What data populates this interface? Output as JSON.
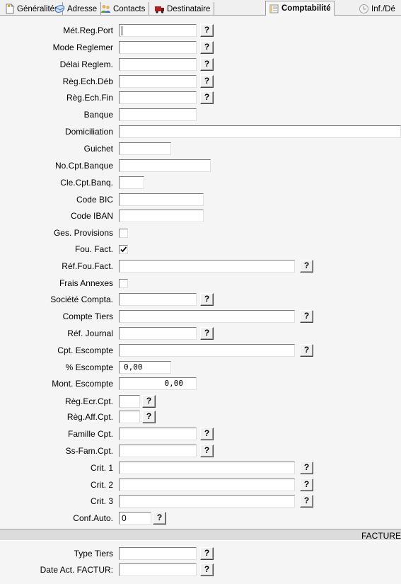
{
  "tabs": [
    {
      "label": "Généralités",
      "icon": "page-icon"
    },
    {
      "label": "Adresse",
      "icon": "envelope-icon"
    },
    {
      "label": "Contacts",
      "icon": "people-icon"
    },
    {
      "label": "Destinataire",
      "icon": "truck-icon"
    },
    {
      "label": "Comptabilité",
      "icon": "ledger-icon",
      "active": true
    },
    {
      "label": "Inf./Dé",
      "icon": "clock-icon"
    }
  ],
  "fields": {
    "met_reg_port": {
      "label": "Mét.Reg.Port",
      "value": ""
    },
    "mode_reglement": {
      "label": "Mode Reglemer",
      "value": ""
    },
    "delai_reglem": {
      "label": "Délai Reglem.",
      "value": ""
    },
    "reg_ech_deb": {
      "label": "Règ.Ech.Déb",
      "value": ""
    },
    "reg_ech_fin": {
      "label": "Règ.Ech.Fin",
      "value": ""
    },
    "banque": {
      "label": "Banque",
      "value": ""
    },
    "domiciliation": {
      "label": "Domiciliation",
      "value": ""
    },
    "guichet": {
      "label": "Guichet",
      "value": ""
    },
    "no_cpt_banque": {
      "label": "No.Cpt.Banque",
      "value": ""
    },
    "cle_cpt_banq": {
      "label": "Cle.Cpt.Banq.",
      "value": ""
    },
    "code_bic": {
      "label": "Code BIC",
      "value": ""
    },
    "code_iban": {
      "label": "Code IBAN",
      "value": ""
    },
    "ges_provisions": {
      "label": "Ges. Provisions",
      "checked": false
    },
    "fou_fact": {
      "label": "Fou. Fact.",
      "checked": true
    },
    "ref_fou_fact": {
      "label": "Réf.Fou.Fact.",
      "value": ""
    },
    "frais_annexes": {
      "label": "Frais Annexes",
      "checked": false
    },
    "societe_compta": {
      "label": "Société Compta.",
      "value": ""
    },
    "compte_tiers": {
      "label": "Compte Tiers",
      "value": ""
    },
    "ref_journal": {
      "label": "Réf. Journal",
      "value": ""
    },
    "cpt_escompte": {
      "label": "Cpt. Escompte",
      "value": ""
    },
    "pct_escompte": {
      "label": "% Escompte",
      "value": "0,00"
    },
    "mont_escompte": {
      "label": "Mont. Escompte",
      "value": "0,00"
    },
    "reg_ecr_cpt": {
      "label": "Règ.Ecr.Cpt.",
      "value": ""
    },
    "reg_aff_cpt": {
      "label": "Règ.Aff.Cpt.",
      "value": ""
    },
    "famille_cpt": {
      "label": "Famille Cpt.",
      "value": ""
    },
    "ss_fam_cpt": {
      "label": "Ss-Fam.Cpt.",
      "value": ""
    },
    "crit1": {
      "label": "Crit. 1",
      "value": ""
    },
    "crit2": {
      "label": "Crit. 2",
      "value": ""
    },
    "crit3": {
      "label": "Crit. 3",
      "value": ""
    },
    "conf_auto": {
      "label": "Conf.Auto.",
      "value": "0"
    },
    "type_tiers": {
      "label": "Type Tiers",
      "value": ""
    },
    "date_act_factur": {
      "label": "Date Act. FACTUR:",
      "value": ""
    }
  },
  "lookup_button_label": "?",
  "section_band": {
    "label": "FACTURE"
  }
}
